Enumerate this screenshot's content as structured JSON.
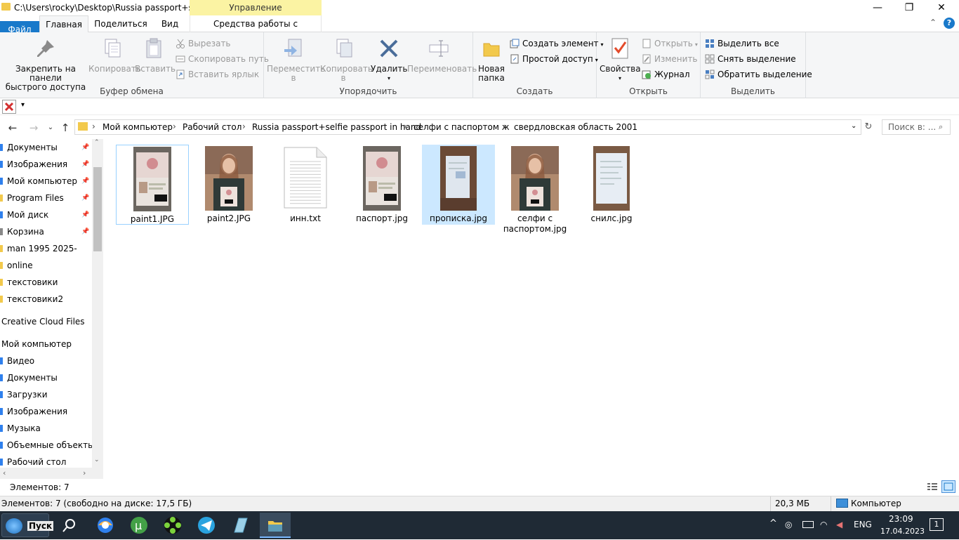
{
  "window": {
    "title": "C:\\Users\\rocky\\Desktop\\Russia passport+self...",
    "context_tab": "Управление",
    "controls": {
      "minimize": "—",
      "maximize": "❐",
      "close": "✕"
    }
  },
  "ribbon_tabs": [
    "Файл",
    "Главная",
    "Поделиться",
    "Вид",
    "Средства работы с рисунками"
  ],
  "ribbon": {
    "clipboard": {
      "label": "Буфер обмена",
      "pin": "Закрепить на панели быстрого доступа",
      "pin_l1": "Закрепить на панели",
      "pin_l2": "быстрого доступа",
      "copy": "Копировать",
      "paste": "Вставить",
      "cut": "Вырезать",
      "copy_path": "Скопировать путь",
      "paste_shortcut": "Вставить ярлык"
    },
    "organize": {
      "label": "Упорядочить",
      "move_l1": "Переместить",
      "move_l2": "в",
      "copyto_l1": "Копировать",
      "copyto_l2": "в",
      "delete": "Удалить",
      "rename": "Переименовать"
    },
    "create": {
      "label": "Создать",
      "new_folder_l1": "Новая",
      "new_folder_l2": "папка",
      "new_item": "Создать элемент",
      "easy_access": "Простой доступ"
    },
    "open": {
      "label": "Открыть",
      "properties": "Свойства",
      "open": "Открыть",
      "edit": "Изменить",
      "history": "Журнал"
    },
    "select": {
      "label": "Выделить",
      "select_all": "Выделить все",
      "select_none": "Снять выделение",
      "invert": "Обратить выделение"
    }
  },
  "breadcrumb": [
    "Мой компьютер",
    "Рабочий стол",
    "Russia passport+selfie passport in hand",
    "селфи с паспортом ж",
    "свердловская область 2001"
  ],
  "search": {
    "placeholder": "Поиск в: ..."
  },
  "nav_items": [
    {
      "label": "Документы",
      "pinned": true
    },
    {
      "label": "Изображения",
      "pinned": true
    },
    {
      "label": "Мой компьютер",
      "pinned": true
    },
    {
      "label": "Program Files",
      "pinned": true
    },
    {
      "label": "Мой диск",
      "pinned": true
    },
    {
      "label": "Корзина",
      "pinned": true
    },
    {
      "label": "man 1995 2025-",
      "pinned": false
    },
    {
      "label": "online",
      "pinned": false
    },
    {
      "label": "текстовики",
      "pinned": false
    },
    {
      "label": "текстовики2",
      "pinned": false
    },
    {
      "label": "Creative Cloud Files",
      "pinned": false
    },
    {
      "label": "Мой компьютер",
      "pinned": false
    },
    {
      "label": "Видео",
      "pinned": false
    },
    {
      "label": "Документы",
      "pinned": false
    },
    {
      "label": "Загрузки",
      "pinned": false
    },
    {
      "label": "Изображения",
      "pinned": false
    },
    {
      "label": "Музыка",
      "pinned": false
    },
    {
      "label": "Объемные объекты",
      "pinned": false
    },
    {
      "label": "Рабочий стол",
      "pinned": false
    }
  ],
  "files": [
    {
      "name": "paint1.JPG",
      "kind": "passport-photo",
      "state": "focused"
    },
    {
      "name": "paint2.JPG",
      "kind": "selfie-photo",
      "state": ""
    },
    {
      "name": "инн.txt",
      "kind": "text-file",
      "state": ""
    },
    {
      "name": "паспорт.jpg",
      "kind": "passport-photo",
      "state": ""
    },
    {
      "name": "прописка.jpg",
      "kind": "registration-photo",
      "state": "selected"
    },
    {
      "name": "селфи с паспортом.jpg",
      "kind": "selfie-photo",
      "state": ""
    },
    {
      "name": "снилс.jpg",
      "kind": "snils-photo",
      "state": ""
    }
  ],
  "status": {
    "items_count": "Элементов: 7",
    "items_free": "Элементов: 7 (свободно на диске: 17,5 ГБ)",
    "size": "20,3 МБ",
    "location": "Компьютер"
  },
  "taskbar": {
    "start_label": "Пуск",
    "lang": "ENG",
    "time": "23:09",
    "date": "17.04.2023",
    "notifications": "1"
  },
  "colors": {
    "accent": "#1979ca",
    "context_tab": "#fbf3a3",
    "selection": "#cce8ff",
    "taskbar": "#1f2a35"
  }
}
